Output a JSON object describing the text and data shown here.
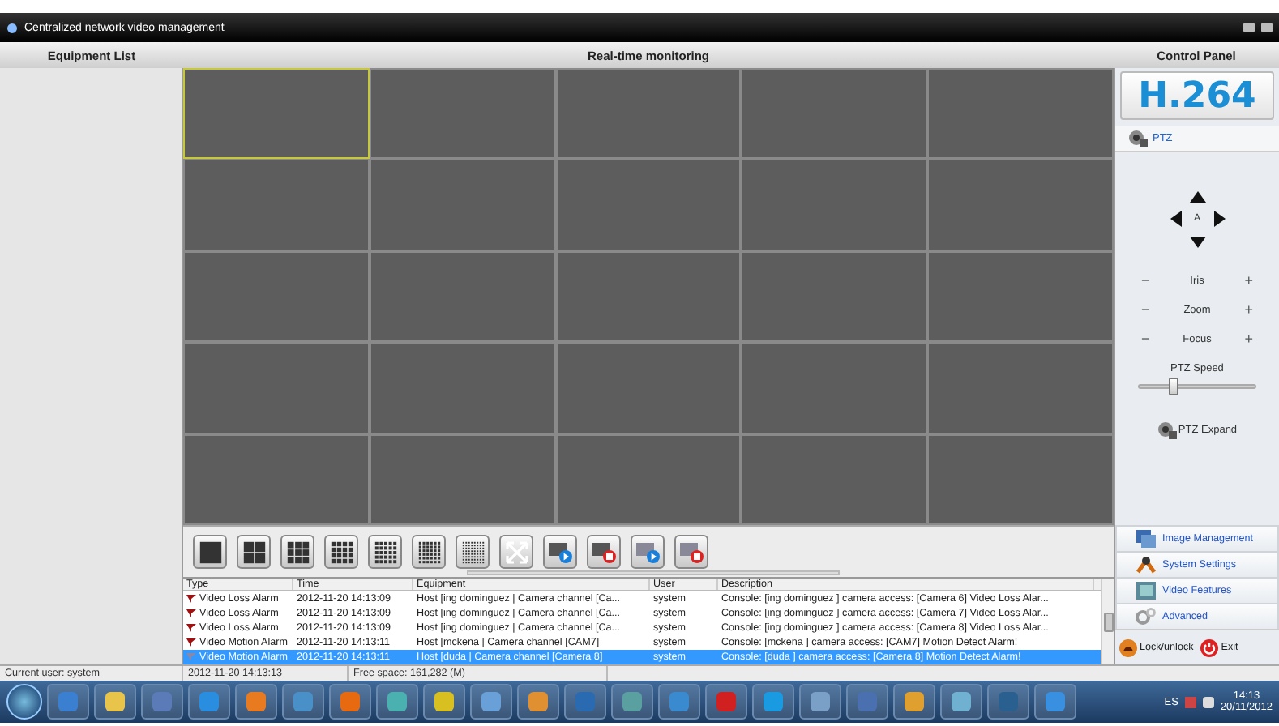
{
  "window": {
    "title": "Centralized network video management"
  },
  "header": {
    "left": "Equipment List",
    "center": "Real-time monitoring",
    "right": "Control Panel"
  },
  "video_grid": {
    "cells": [
      {
        "selected": true
      },
      {
        "selected": false
      },
      {
        "selected": false
      },
      {
        "selected": false
      },
      {
        "selected": false
      },
      {
        "selected": false
      },
      {
        "selected": false
      },
      {
        "selected": false
      },
      {
        "selected": false
      },
      {
        "selected": false
      },
      {
        "selected": false
      },
      {
        "selected": false
      },
      {
        "selected": false
      },
      {
        "selected": false
      },
      {
        "selected": false
      },
      {
        "selected": false
      },
      {
        "selected": false
      },
      {
        "selected": false
      },
      {
        "selected": false
      },
      {
        "selected": false
      },
      {
        "selected": false
      },
      {
        "selected": false
      },
      {
        "selected": false
      },
      {
        "selected": false
      },
      {
        "selected": false
      }
    ]
  },
  "toolbar": [
    {
      "kind": "grid1"
    },
    {
      "kind": "grid2"
    },
    {
      "kind": "grid3"
    },
    {
      "kind": "grid4"
    },
    {
      "kind": "grid5"
    },
    {
      "kind": "grid6"
    },
    {
      "kind": "grid8"
    },
    {
      "kind": "fullscreen"
    },
    {
      "kind": "record-start"
    },
    {
      "kind": "record-stop"
    },
    {
      "kind": "capture-start"
    },
    {
      "kind": "capture-stop"
    }
  ],
  "log": {
    "columns": [
      "Type",
      "Time",
      "Equipment",
      "User",
      "Description"
    ],
    "rows": [
      {
        "type": "Video Loss Alarm",
        "time": "2012-11-20 14:13:09",
        "equipment": "Host [ing dominguez | Camera channel [Ca...",
        "user": "system",
        "description": "Console: [ing dominguez ] camera access: [Camera 6] Video Loss Alar...",
        "selected": false
      },
      {
        "type": "Video Loss Alarm",
        "time": "2012-11-20 14:13:09",
        "equipment": "Host [ing dominguez | Camera channel [Ca...",
        "user": "system",
        "description": "Console: [ing dominguez ] camera access: [Camera 7] Video Loss Alar...",
        "selected": false
      },
      {
        "type": "Video Loss Alarm",
        "time": "2012-11-20 14:13:09",
        "equipment": "Host [ing dominguez | Camera channel [Ca...",
        "user": "system",
        "description": "Console: [ing dominguez ] camera access: [Camera 8] Video Loss Alar...",
        "selected": false
      },
      {
        "type": "Video Motion Alarm",
        "time": "2012-11-20 14:13:11",
        "equipment": "Host [mckena | Camera channel [CAM7]",
        "user": "system",
        "description": "Console: [mckena ] camera access: [CAM7] Motion Detect Alarm!",
        "selected": false
      },
      {
        "type": "Video Motion Alarm",
        "time": "2012-11-20 14:13:11",
        "equipment": "Host [duda | Camera channel [Camera 8]",
        "user": "system",
        "description": "Console: [duda ] camera access: [Camera 8] Motion Detect Alarm!",
        "selected": true
      }
    ]
  },
  "status_bar": [
    "Current user: system",
    "2012-11-20 14:13:13",
    "Free space: 161,282 (M)"
  ],
  "control_panel": {
    "logo": "H.264",
    "tab": "PTZ",
    "center": "A",
    "adjust": [
      {
        "minus": "−",
        "label": "Iris",
        "plus": "+"
      },
      {
        "minus": "−",
        "label": "Zoom",
        "plus": "+"
      },
      {
        "minus": "−",
        "label": "Focus",
        "plus": "+"
      }
    ],
    "speed_label": "PTZ Speed",
    "speed": {
      "level": 0.3
    },
    "expand": "PTZ Expand",
    "menu": [
      {
        "kind": "images",
        "label": "Image Management"
      },
      {
        "kind": "tools",
        "label": "System Settings"
      },
      {
        "kind": "video",
        "label": "Video Features"
      },
      {
        "kind": "gears",
        "label": "Advanced"
      }
    ],
    "lock": "Lock/unlock",
    "exit": "Exit"
  },
  "taskbar": {
    "apps": [
      {
        "color": "#3a7fd0"
      },
      {
        "color": "#e8c44a"
      },
      {
        "color": "#5a7ab8"
      },
      {
        "color": "#2a8ee0"
      },
      {
        "color": "#e87a20"
      },
      {
        "color": "#4a90c8"
      },
      {
        "color": "#e86a10"
      },
      {
        "color": "#4ab0b0"
      },
      {
        "color": "#d8c020"
      },
      {
        "color": "#6aa0d8"
      },
      {
        "color": "#e09030"
      },
      {
        "color": "#2a6ab0"
      },
      {
        "color": "#5aa0a0"
      },
      {
        "color": "#3a8ad0"
      },
      {
        "color": "#d02020"
      },
      {
        "color": "#1a9ae0"
      },
      {
        "color": "#7aa0c8"
      },
      {
        "color": "#4a70b0"
      },
      {
        "color": "#e0a030"
      },
      {
        "color": "#70b0d0"
      },
      {
        "color": "#2a6090"
      },
      {
        "color": "#3a90e0"
      }
    ],
    "language": "ES",
    "time": "14:13",
    "date": "20/11/2012"
  }
}
